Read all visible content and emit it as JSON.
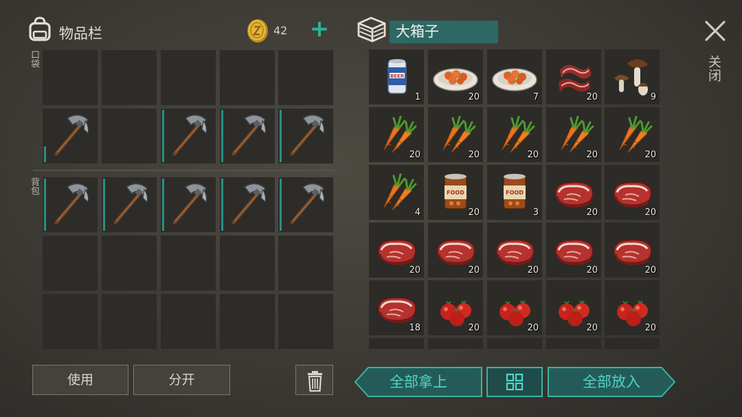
{
  "inventory": {
    "title": "物品栏",
    "coins": "42",
    "pocket_label": "口袋",
    "backpack_label": "背包",
    "pocket_rows": [
      [
        {
          "item": null
        },
        {
          "item": null
        },
        {
          "item": null
        },
        {
          "item": null
        },
        {
          "item": null
        }
      ],
      [
        {
          "item": "pickaxe",
          "durability": 0.3
        },
        {
          "item": null
        },
        {
          "item": "pickaxe",
          "durability": 1
        },
        {
          "item": "pickaxe",
          "durability": 1
        },
        {
          "item": "pickaxe",
          "durability": 1
        }
      ]
    ],
    "backpack_rows": [
      [
        {
          "item": "pickaxe",
          "durability": 1
        },
        {
          "item": "pickaxe",
          "durability": 1
        },
        {
          "item": "pickaxe",
          "durability": 1
        },
        {
          "item": "pickaxe",
          "durability": 1
        },
        {
          "item": "pickaxe",
          "durability": 1
        }
      ],
      [
        {
          "item": null
        },
        {
          "item": null
        },
        {
          "item": null
        },
        {
          "item": null
        },
        {
          "item": null
        }
      ],
      [
        {
          "item": null
        },
        {
          "item": null
        },
        {
          "item": null
        },
        {
          "item": null
        },
        {
          "item": null
        }
      ]
    ],
    "use_label": "使用",
    "split_label": "分开"
  },
  "chest": {
    "title": "大箱子",
    "rows": [
      [
        {
          "item": "beer-can",
          "qty": "1"
        },
        {
          "item": "cooked-dish",
          "qty": "20"
        },
        {
          "item": "cooked-dish",
          "qty": "7"
        },
        {
          "item": "bacon",
          "qty": "20"
        },
        {
          "item": "mushroom",
          "qty": "9"
        }
      ],
      [
        {
          "item": "carrot",
          "qty": "20"
        },
        {
          "item": "carrot",
          "qty": "20"
        },
        {
          "item": "carrot",
          "qty": "20"
        },
        {
          "item": "carrot",
          "qty": "20"
        },
        {
          "item": "carrot",
          "qty": "20"
        }
      ],
      [
        {
          "item": "carrot",
          "qty": "4"
        },
        {
          "item": "canned-food",
          "qty": "20"
        },
        {
          "item": "canned-food",
          "qty": "3"
        },
        {
          "item": "raw-steak",
          "qty": "20"
        },
        {
          "item": "raw-steak",
          "qty": "20"
        }
      ],
      [
        {
          "item": "raw-steak",
          "qty": "20"
        },
        {
          "item": "raw-steak",
          "qty": "20"
        },
        {
          "item": "raw-steak",
          "qty": "20"
        },
        {
          "item": "raw-steak",
          "qty": "20"
        },
        {
          "item": "raw-steak",
          "qty": "20"
        }
      ],
      [
        {
          "item": "raw-steak",
          "qty": "18"
        },
        {
          "item": "tomato",
          "qty": "20"
        },
        {
          "item": "tomato",
          "qty": "20"
        },
        {
          "item": "tomato",
          "qty": "20"
        },
        {
          "item": "tomato",
          "qty": "20"
        }
      ],
      [
        {
          "item": null
        },
        {
          "item": null
        },
        {
          "item": null
        },
        {
          "item": null
        },
        {
          "item": null
        }
      ]
    ],
    "take_all_label": "全部拿上",
    "put_all_label": "全部放入"
  },
  "close_label": "关闭",
  "colors": {
    "accent": "#2fb1a2",
    "button_text": "#4fd6c7",
    "slot": "#2d2c29",
    "durability": "#2a8e84"
  }
}
